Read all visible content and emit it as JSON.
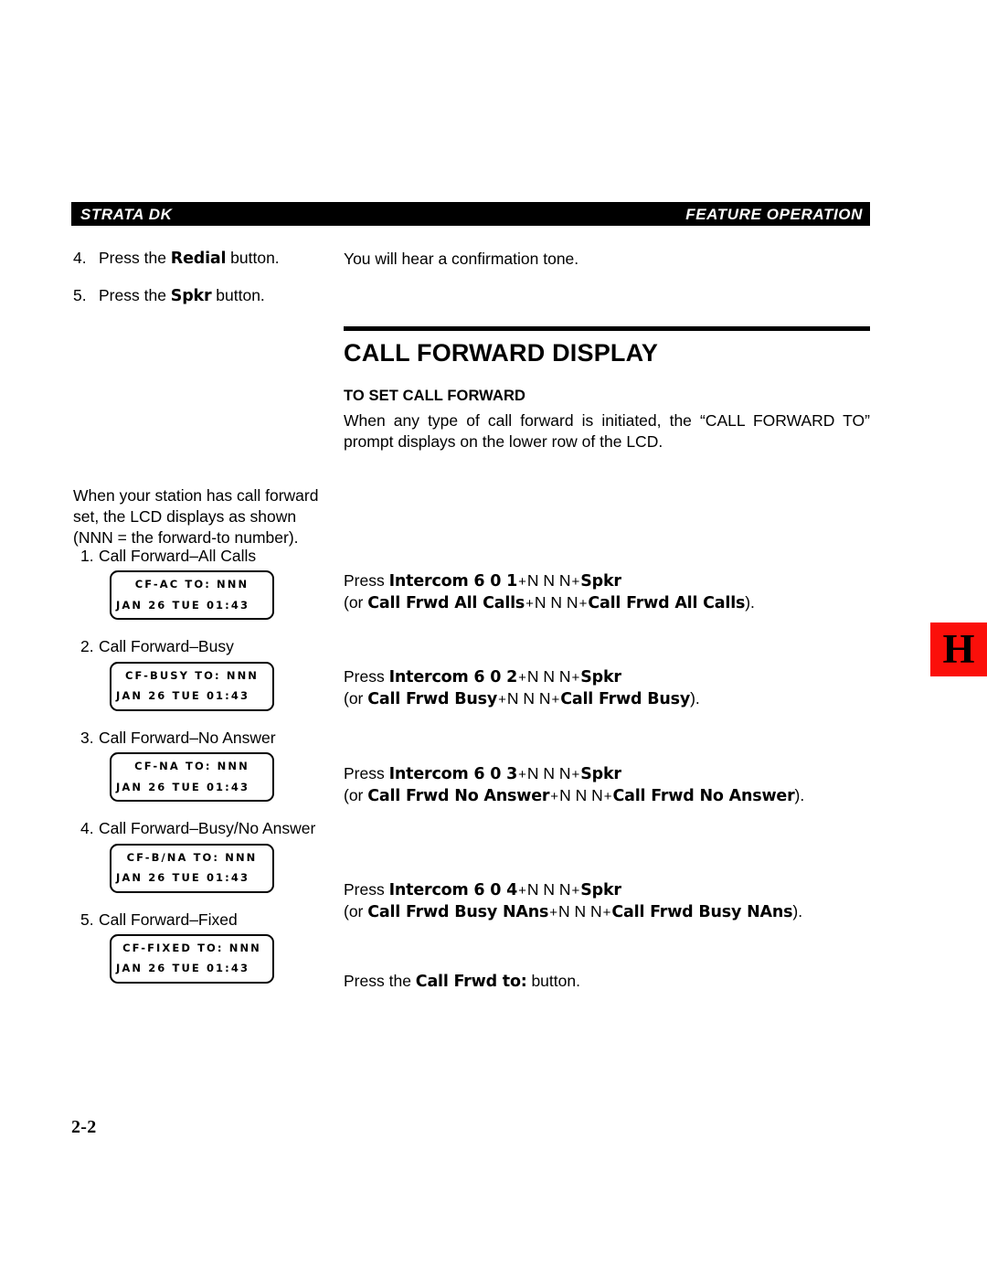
{
  "header": {
    "left_title": "STRATA DK",
    "right_title": "FEATURE OPERATION"
  },
  "thumb_tab": {
    "letter": "H",
    "color": "#fb0f0a"
  },
  "page_number": "2-2",
  "top_steps": [
    {
      "num": "4.",
      "before": "Press the ",
      "button": "Redial",
      "after": " button."
    },
    {
      "num": "5.",
      "before": "Press the ",
      "button": "Spkr",
      "after": " button."
    }
  ],
  "top_right_note": "You will hear a confirmation tone.",
  "section": {
    "title": "CALL FORWARD DISPLAY",
    "subtitle": "TO SET CALL FORWARD",
    "paragraph": "When any type of call forward is initiated, the “CALL FORWARD TO” prompt displays on the lower row of the LCD."
  },
  "intro_paragraph": "When your station has call forward set, the LCD displays as shown (NNN = the forward-to number).",
  "cf_items": [
    {
      "num": "1.",
      "label": "Call Forward–All Calls",
      "lcd_top": "CF-AC TO: NNN",
      "lcd_bottom": "JAN 26 TUE 01:43"
    },
    {
      "num": "2.",
      "label": "Call Forward–Busy",
      "lcd_top": "CF-BUSY TO: NNN",
      "lcd_bottom": "JAN 26 TUE 01:43"
    },
    {
      "num": "3.",
      "label": "Call Forward–No Answer",
      "lcd_top": "CF-NA TO: NNN",
      "lcd_bottom": "JAN 26 TUE 01:43"
    },
    {
      "num": "4.",
      "label": "Call Forward–Busy/No Answer",
      "lcd_top": "CF-B/NA TO: NNN",
      "lcd_bottom": "JAN 26 TUE 01:43"
    },
    {
      "num": "5.",
      "label": "Call Forward–Fixed",
      "lcd_top": "CF-FIXED TO: NNN",
      "lcd_bottom": "JAN 26 TUE 01:43"
    }
  ],
  "instructions": [
    {
      "press_word": "Press ",
      "primary_button": "Intercom 6 0 1",
      "plus_1": "+",
      "digits": "N N N",
      "plus_2": "+",
      "secondary_button": "Spkr",
      "alt_open": "(or ",
      "alt_button_1": "Call Frwd All Calls",
      "alt_plus_1": "+",
      "alt_digits": "N N N",
      "alt_plus_2": "+",
      "alt_button_2": "Call Frwd All Calls",
      "alt_close": ")."
    },
    {
      "press_word": "Press ",
      "primary_button": "Intercom 6 0 2",
      "plus_1": "+",
      "digits": "N N N",
      "plus_2": "+",
      "secondary_button": "Spkr",
      "alt_open": "(or ",
      "alt_button_1": "Call Frwd Busy",
      "alt_plus_1": "+",
      "alt_digits": "N N N",
      "alt_plus_2": "+",
      "alt_button_2": "Call Frwd Busy",
      "alt_close": ")."
    },
    {
      "press_word": "Press ",
      "primary_button": "Intercom 6 0 3",
      "plus_1": "+",
      "digits": "N N N",
      "plus_2": "+",
      "secondary_button": "Spkr",
      "alt_open": "(or ",
      "alt_button_1": "Call Frwd No Answer",
      "alt_plus_1": "+",
      "alt_digits": "N N N",
      "alt_plus_2": "+",
      "alt_button_2": "Call Frwd No Answer",
      "alt_close": ")."
    },
    {
      "press_word": "Press ",
      "primary_button": "Intercom 6 0 4",
      "plus_1": "+",
      "digits": "N N N",
      "plus_2": "+",
      "secondary_button": "Spkr",
      "alt_open": "(or ",
      "alt_button_1": "Call Frwd Busy NAns",
      "alt_plus_1": "+",
      "alt_digits": "N N N",
      "alt_plus_2": "+",
      "alt_button_2": "Call Frwd Busy NAns",
      "alt_close": ")."
    }
  ],
  "fixed_instruction": {
    "before": "Press the ",
    "button": "Call Frwd to:",
    "after": " button."
  }
}
